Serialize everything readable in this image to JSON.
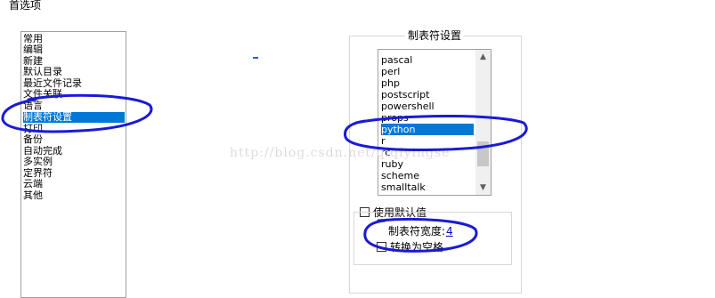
{
  "window": {
    "title": "首选项"
  },
  "categories": [
    {
      "label": "常用"
    },
    {
      "label": "编辑"
    },
    {
      "label": "新建"
    },
    {
      "label": "默认目录"
    },
    {
      "label": "最近文件记录"
    },
    {
      "label": "文件关联"
    },
    {
      "label": "语言"
    },
    {
      "label": "制表符设置",
      "selected": true
    },
    {
      "label": "打印"
    },
    {
      "label": "备份"
    },
    {
      "label": "自动完成"
    },
    {
      "label": "多实例"
    },
    {
      "label": "定界符"
    },
    {
      "label": "云端"
    },
    {
      "label": "其他"
    }
  ],
  "tab_settings": {
    "group_title": "制表符设置",
    "languages": [
      {
        "label": "pascal"
      },
      {
        "label": "perl"
      },
      {
        "label": "php"
      },
      {
        "label": "postscript"
      },
      {
        "label": "powershell"
      },
      {
        "label": "props"
      },
      {
        "label": "python",
        "selected": true
      },
      {
        "label": "r"
      },
      {
        "label": "rc"
      },
      {
        "label": "ruby"
      },
      {
        "label": "scheme"
      },
      {
        "label": "smalltalk"
      }
    ],
    "use_default_label": "使用默认值",
    "use_default_checked": false,
    "tab_width_label": "制表符宽度:",
    "tab_width_value": "4",
    "replace_by_space_label": "转换为空格",
    "replace_by_space_checked": false
  },
  "icons": {
    "scroll_up": "▲",
    "scroll_down": "▼"
  },
  "watermark": "http://blog.csdn.net/qiqiyingse",
  "colors": {
    "selection": "#0078d7",
    "annotation": "#1a1ad6"
  }
}
